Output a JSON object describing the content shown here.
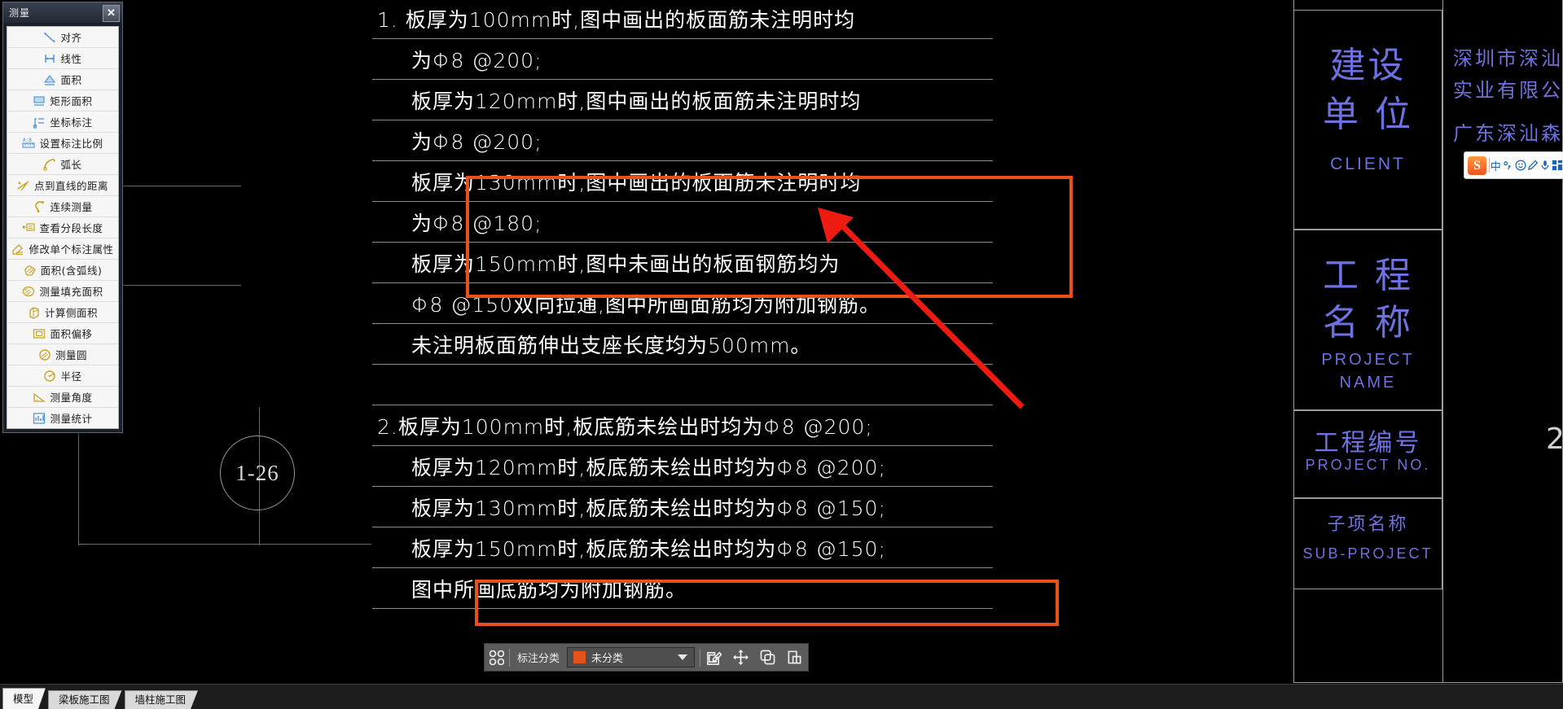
{
  "app": {
    "title_bar": {
      "title": "测量",
      "close_label": "✕"
    }
  },
  "measure_panel": {
    "items": [
      {
        "label": "对齐",
        "icon": "align-dimension-icon"
      },
      {
        "label": "线性",
        "icon": "linear-dimension-icon"
      },
      {
        "label": "面积",
        "icon": "area-icon"
      },
      {
        "label": "矩形面积",
        "icon": "rectangle-area-icon"
      },
      {
        "label": "坐标标注",
        "icon": "coordinate-dimension-icon"
      },
      {
        "label": "设置标注比例",
        "icon": "dimension-scale-icon"
      },
      {
        "label": "弧长",
        "icon": "arc-length-icon"
      },
      {
        "label": "点到直线的距离",
        "icon": "point-to-line-icon"
      },
      {
        "label": "连续测量",
        "icon": "continuous-measure-icon"
      },
      {
        "label": "查看分段长度",
        "icon": "segment-length-icon"
      },
      {
        "label": "修改单个标注属性",
        "icon": "edit-dimension-icon"
      },
      {
        "label": "面积(含弧线)",
        "icon": "area-with-arc-icon"
      },
      {
        "label": "测量填充面积",
        "icon": "hatch-area-icon"
      },
      {
        "label": "计算侧面积",
        "icon": "side-area-icon"
      },
      {
        "label": "面积偏移",
        "icon": "area-offset-icon"
      },
      {
        "label": "测量圆",
        "icon": "measure-circle-icon"
      },
      {
        "label": "半径",
        "icon": "radius-icon"
      },
      {
        "label": "测量角度",
        "icon": "measure-angle-icon"
      },
      {
        "label": "测量统计",
        "icon": "measure-statistics-icon"
      }
    ]
  },
  "drawing": {
    "grid_label": "1-26",
    "notes": [
      {
        "text": "1. 板厚为100mm时,图中画出的板面筋未注明时均",
        "indent": 0
      },
      {
        "text": "为Φ8 @200;",
        "indent": 1
      },
      {
        "text": "板厚为120mm时,图中画出的板面筋未注明时均",
        "indent": 1
      },
      {
        "text": "为Φ8 @200;",
        "indent": 1
      },
      {
        "text": "板厚为130mm时,图中画出的板面筋未注明时均",
        "indent": 1
      },
      {
        "text": "为Φ8 @180;",
        "indent": 1
      },
      {
        "text": "板厚为150mm时,图中未画出的板面钢筋均为",
        "indent": 1
      },
      {
        "text": "Φ8 @150双向拉通,图中所画面筋均为附加钢筋。",
        "indent": 1
      },
      {
        "text": "未注明板面筋伸出支座长度均为500mm。",
        "indent": 1
      },
      {
        "text": "",
        "indent": 0
      },
      {
        "text": "2.板厚为100mm时,板底筋未绘出时均为Φ8 @200;",
        "indent": 0
      },
      {
        "text": "板厚为120mm时,板底筋未绘出时均为Φ8 @200;",
        "indent": 1
      },
      {
        "text": "板厚为130mm时,板底筋未绘出时均为Φ8 @150;",
        "indent": 1
      },
      {
        "text": "板厚为150mm时,板底筋未绘出时均为Φ8 @150;",
        "indent": 1
      },
      {
        "text": "图中所画底筋均为附加钢筋。",
        "indent": 1
      }
    ]
  },
  "title_block": {
    "rows": [
      {
        "cn": "建设\n单位",
        "en": "CLIENT",
        "name": "client"
      },
      {
        "cn": "工程\n名 称",
        "en": "PROJECT\nNAME",
        "name": "project-name"
      },
      {
        "cn": "工程编号",
        "en": "PROJECT NO.",
        "name": "project-no"
      },
      {
        "cn": "子项名称",
        "en": "SUB-PROJECT",
        "name": "sub-project"
      }
    ],
    "client_text_lines": [
      "深圳市深汕特",
      "实业有限公司",
      "广东深汕森林"
    ],
    "right_number": "2"
  },
  "annotation_toolbar": {
    "grip_icon": "grid-handle-icon",
    "category_label": "标注分类",
    "selected_category": "未分类",
    "category_color": "#e8511a",
    "buttons": [
      {
        "name": "edit-annotation-button",
        "icon": "pencil-square-icon"
      },
      {
        "name": "move-annotation-button",
        "icon": "move-arrows-icon"
      },
      {
        "name": "copy-annotation-button",
        "icon": "copy-icon"
      },
      {
        "name": "paste-annotation-button",
        "icon": "paste-icon"
      }
    ]
  },
  "taskbar": {
    "tabs": [
      {
        "label": "模型",
        "selected": true
      },
      {
        "label": "梁板施工图",
        "selected": false
      },
      {
        "label": "墙柱施工图",
        "selected": false
      }
    ]
  },
  "ime": {
    "logo": "S",
    "mode": "中",
    "buttons": [
      {
        "name": "punctuation-icon",
        "glyph": "°,"
      },
      {
        "name": "emoji-icon",
        "glyph": "☺"
      },
      {
        "name": "pen-icon",
        "glyph": "✎"
      },
      {
        "name": "microphone-icon",
        "glyph": "🎤"
      },
      {
        "name": "apps-grid-icon",
        "glyph": "▦"
      }
    ]
  },
  "colors": {
    "accent_orange": "#e8511a",
    "arrow_red": "#ee1c10",
    "cad_text": "#ffffff",
    "title_block_blue": "#6e71e0"
  }
}
